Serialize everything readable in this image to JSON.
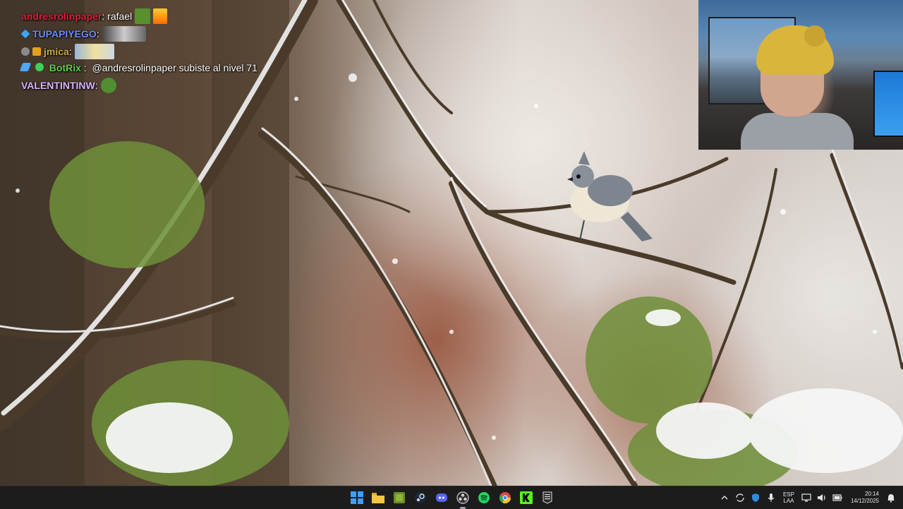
{
  "chat": {
    "messages": [
      {
        "user": "andresrolinpaper",
        "user_color": "#e0203a",
        "text": "rafael",
        "emotes": [
          "pepe-soldier-emote",
          "fire-emote"
        ]
      },
      {
        "user": "TUPAPIYEGO",
        "user_color": "#6a8cff",
        "text": "",
        "emotes": [
          "image-emote"
        ]
      },
      {
        "user": "jmica",
        "user_color": "#c8a64a",
        "text": "",
        "emotes": [
          "meme-emote"
        ]
      },
      {
        "user": "BotRix",
        "user_color": "#5ccf4a",
        "text": "@andresrolinpaper subiste al nivel 71",
        "emotes": []
      },
      {
        "user": "VALENTINTINW",
        "user_color": "#d8b4ff",
        "text": "",
        "emotes": [
          "pepe-emote"
        ]
      }
    ]
  },
  "taskbar": {
    "apps": [
      {
        "name": "windows-start-icon",
        "color": "#3aa0ff"
      },
      {
        "name": "file-explorer-icon",
        "color": "#f5c542"
      },
      {
        "name": "game-app-icon",
        "color": "#6b8e23"
      },
      {
        "name": "steam-icon",
        "color": "#5a9bd4"
      },
      {
        "name": "discord-icon",
        "color": "#5865f2"
      },
      {
        "name": "obs-icon",
        "color": "#cfcfcf"
      },
      {
        "name": "spotify-icon",
        "color": "#1ed760"
      },
      {
        "name": "chrome-icon",
        "color": "#e04b3a"
      },
      {
        "name": "kick-icon",
        "color": "#53fc18"
      },
      {
        "name": "epic-games-icon",
        "color": "#dddddd"
      }
    ],
    "tray": {
      "language": "ESP",
      "layout": "LAA",
      "time": "20:14",
      "date": "14/12/2025"
    }
  },
  "colors": {
    "taskbar_bg": "#1c1c1c"
  }
}
